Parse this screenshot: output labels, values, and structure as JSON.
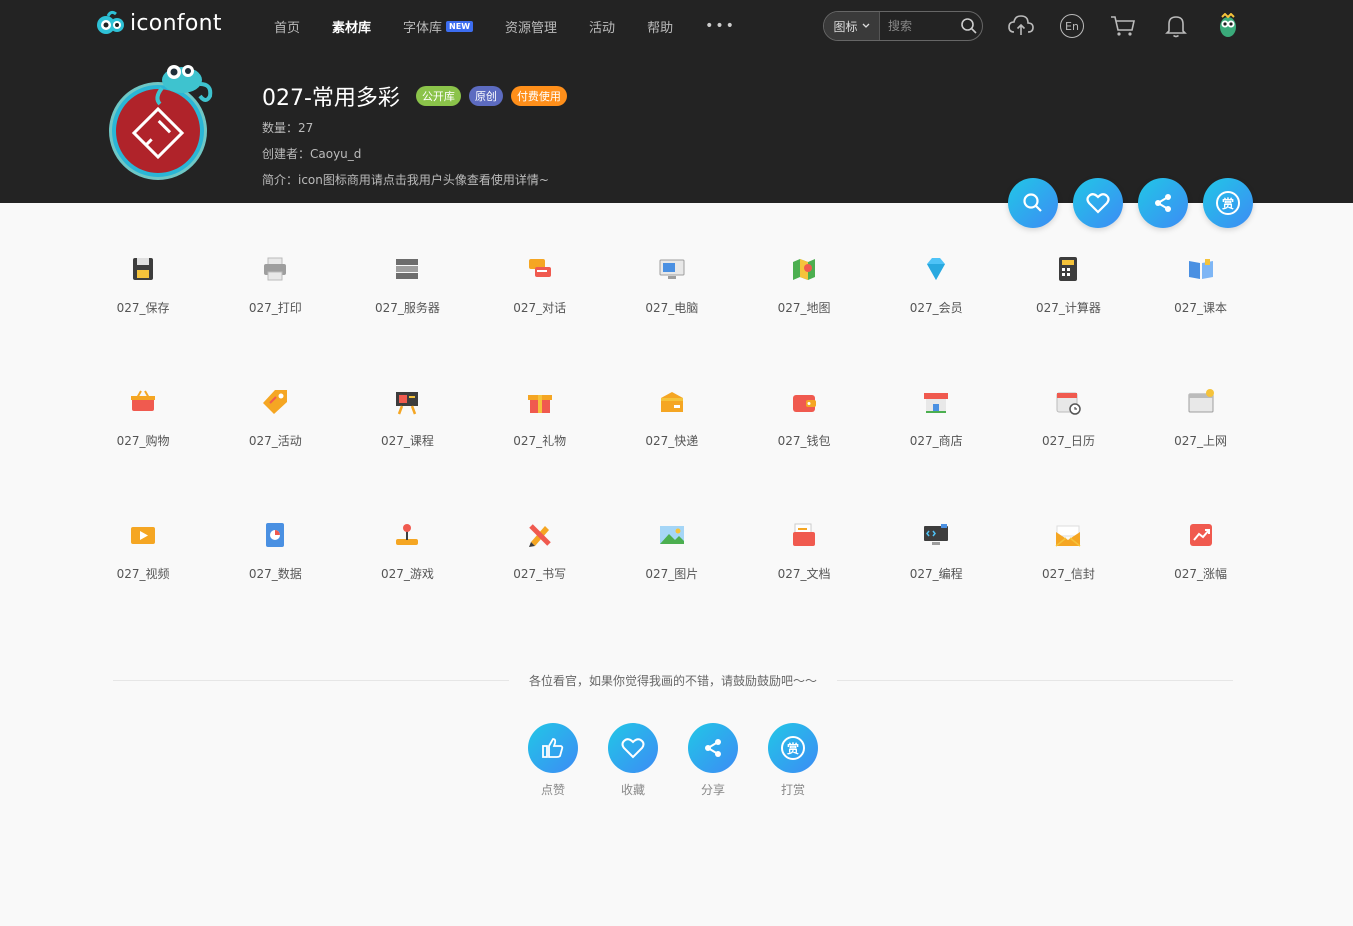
{
  "header": {
    "logo_text": "iconfont",
    "nav": [
      {
        "label": "首页",
        "active": false
      },
      {
        "label": "素材库",
        "active": true
      },
      {
        "label": "字体库",
        "active": false,
        "badge": "NEW"
      },
      {
        "label": "资源管理",
        "active": false
      },
      {
        "label": "活动",
        "active": false
      },
      {
        "label": "帮助",
        "active": false
      },
      {
        "label": "•••",
        "active": false
      }
    ],
    "search": {
      "type": "图标",
      "placeholder": "搜索"
    },
    "lang_label": "En"
  },
  "collection": {
    "title": "027-常用多彩",
    "tags": [
      {
        "label": "公开库",
        "color": "#8bc34a"
      },
      {
        "label": "原创",
        "color": "#5c6bc0"
      },
      {
        "label": "付费使用",
        "color": "#ff8f1a"
      }
    ],
    "count": "数量：27",
    "creator": "创建者：Caoyu_d",
    "intro": "简介：icon图标商用请点击我用户头像查看使用详情~"
  },
  "icons": [
    {
      "label": "027_保存",
      "icon": "save-icon"
    },
    {
      "label": "027_打印",
      "icon": "printer-icon"
    },
    {
      "label": "027_服务器",
      "icon": "server-icon"
    },
    {
      "label": "027_对话",
      "icon": "chat-icon"
    },
    {
      "label": "027_电脑",
      "icon": "computer-icon"
    },
    {
      "label": "027_地图",
      "icon": "map-icon"
    },
    {
      "label": "027_会员",
      "icon": "diamond-icon"
    },
    {
      "label": "027_计算器",
      "icon": "calculator-icon"
    },
    {
      "label": "027_课本",
      "icon": "book-icon"
    },
    {
      "label": "027_购物",
      "icon": "basket-icon"
    },
    {
      "label": "027_活动",
      "icon": "tag-icon"
    },
    {
      "label": "027_课程",
      "icon": "easel-icon"
    },
    {
      "label": "027_礼物",
      "icon": "gift-icon"
    },
    {
      "label": "027_快递",
      "icon": "package-icon"
    },
    {
      "label": "027_钱包",
      "icon": "wallet-icon"
    },
    {
      "label": "027_商店",
      "icon": "store-icon"
    },
    {
      "label": "027_日历",
      "icon": "calendar-icon"
    },
    {
      "label": "027_上网",
      "icon": "browser-icon"
    },
    {
      "label": "027_视频",
      "icon": "video-icon"
    },
    {
      "label": "027_数据",
      "icon": "pie-doc-icon"
    },
    {
      "label": "027_游戏",
      "icon": "joystick-icon"
    },
    {
      "label": "027_书写",
      "icon": "pencil-icon"
    },
    {
      "label": "027_图片",
      "icon": "image-icon"
    },
    {
      "label": "027_文档",
      "icon": "folder-doc-icon"
    },
    {
      "label": "027_编程",
      "icon": "code-monitor-icon"
    },
    {
      "label": "027_信封",
      "icon": "envelope-icon"
    },
    {
      "label": "027_涨幅",
      "icon": "trend-up-icon"
    }
  ],
  "footer": {
    "message": "各位看官，如果你觉得我画的不错，请鼓励鼓励吧～～",
    "actions": [
      {
        "label": "点赞",
        "icon": "thumbs-up-icon"
      },
      {
        "label": "收藏",
        "icon": "heart-icon"
      },
      {
        "label": "分享",
        "icon": "share-icon"
      },
      {
        "label": "打赏",
        "icon": "reward-icon"
      }
    ],
    "reward_glyph": "赏"
  },
  "colors": {
    "dark": "#232323",
    "accent_from": "#21c7e6",
    "accent_to": "#3d8bf5"
  }
}
